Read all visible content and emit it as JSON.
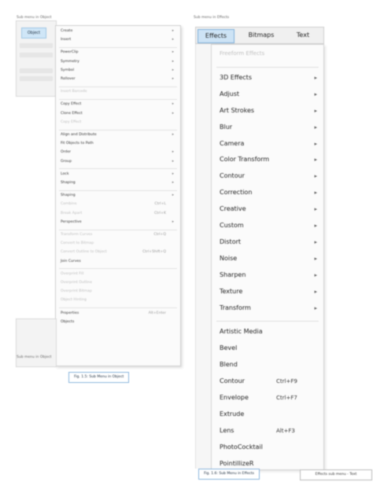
{
  "left": {
    "caption": "Sub menu in Object",
    "app_fragment_label": "Obj",
    "tab_label": "Object",
    "bottom_caption": "Sub menu in Object",
    "figure_caption": "Fig. 1.5: Sub Menu in Object",
    "menu_items": [
      {
        "label": "Create",
        "arrow": true
      },
      {
        "label": "Insert",
        "arrow": true
      },
      {
        "sep": true
      },
      {
        "label": "PowerClip",
        "arrow": true
      },
      {
        "label": "Symmetry",
        "arrow": true
      },
      {
        "label": "Symbol",
        "arrow": true
      },
      {
        "label": "Rollover",
        "arrow": true
      },
      {
        "sep": true
      },
      {
        "label": "Insert Barcode",
        "disabled": true
      },
      {
        "sep": true
      },
      {
        "label": "Copy Effect",
        "arrow": true
      },
      {
        "label": "Clone Effect",
        "arrow": true
      },
      {
        "label": "Copy Effect",
        "disabled": true
      },
      {
        "sep": true
      },
      {
        "label": "Align and Distribute",
        "arrow": true
      },
      {
        "label": "Fit Objects to Path"
      },
      {
        "label": "Order",
        "arrow": true
      },
      {
        "label": "Group",
        "arrow": true
      },
      {
        "sep": true
      },
      {
        "label": "Lock",
        "arrow": true
      },
      {
        "label": "Shaping",
        "arrow": true
      },
      {
        "sep": true
      },
      {
        "label": "Shaping",
        "arrow": true
      },
      {
        "label": "Combine",
        "disabled": true,
        "shortcut": "Ctrl+L"
      },
      {
        "label": "Break Apart",
        "disabled": true,
        "shortcut": "Ctrl+K"
      },
      {
        "label": "Perspective",
        "arrow": true
      },
      {
        "sep": true
      },
      {
        "label": "Transform Curves",
        "disabled": true,
        "shortcut": "Ctrl+Q"
      },
      {
        "label": "Convert to Bitmap",
        "disabled": true
      },
      {
        "label": "Convert Outline to Object",
        "disabled": true,
        "shortcut": "Ctrl+Shift+Q"
      },
      {
        "label": "Join Curves"
      },
      {
        "sep": true
      },
      {
        "label": "Overprint Fill",
        "disabled": true
      },
      {
        "label": "Overprint Outline",
        "disabled": true
      },
      {
        "label": "Overprint Bitmap",
        "disabled": true
      },
      {
        "label": "Object Hinting",
        "disabled": true
      },
      {
        "sep": true
      },
      {
        "label": "Properties",
        "shortcut": "Alt+Enter"
      },
      {
        "label": "Objects"
      }
    ]
  },
  "right": {
    "caption": "Sub menu in Effects",
    "tabs": [
      "Effects",
      "Bitmaps",
      "Text"
    ],
    "figure_caption": "Fig. 1.6: Sub Menu in Effects",
    "tooltip": "Effects sub menu - Text",
    "menu_items": [
      {
        "label": "Freeform Effects",
        "disabled": true
      },
      {
        "sep": true
      },
      {
        "label": "3D Effects",
        "arrow": true
      },
      {
        "label": "Adjust",
        "arrow": true
      },
      {
        "label": "Art Strokes",
        "arrow": true
      },
      {
        "label": "Blur",
        "arrow": true
      },
      {
        "label": "Camera",
        "arrow": true
      },
      {
        "label": "Color Transform",
        "arrow": true
      },
      {
        "label": "Contour",
        "arrow": true
      },
      {
        "label": "Correction",
        "arrow": true
      },
      {
        "label": "Creative",
        "arrow": true
      },
      {
        "label": "Custom",
        "arrow": true
      },
      {
        "label": "Distort",
        "arrow": true
      },
      {
        "label": "Noise",
        "arrow": true
      },
      {
        "label": "Sharpen",
        "arrow": true
      },
      {
        "label": "Texture",
        "arrow": true
      },
      {
        "label": "Transform",
        "arrow": true
      },
      {
        "sep": true
      },
      {
        "label": "Artistic Media"
      },
      {
        "label": "Bevel"
      },
      {
        "label": "Blend"
      },
      {
        "label": "Contour",
        "shortcut": "Ctrl+F9"
      },
      {
        "label": "Envelope",
        "shortcut": "Ctrl+F7"
      },
      {
        "label": "Extrude"
      },
      {
        "label": "Lens",
        "shortcut": "Alt+F3"
      },
      {
        "label": "PhotoCocktail"
      },
      {
        "label": "PointillizeR"
      }
    ]
  }
}
